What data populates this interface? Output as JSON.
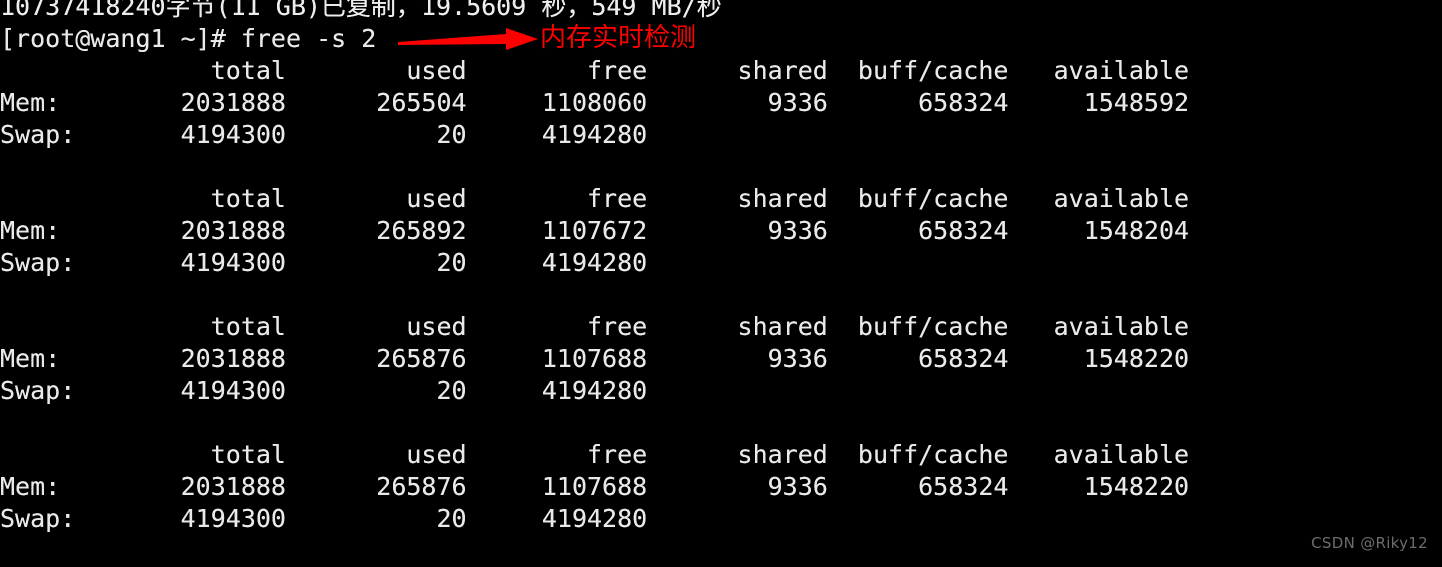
{
  "terminal": {
    "background_color": "#000000",
    "foreground_color": "#e9e9e9",
    "scrollback_top_line": "10737418240字节(11 GB)已复制，19.5609 秒，549 MB/秒",
    "prompt_line": "[root@wang1 ~]# free -s 2"
  },
  "annotation": {
    "color": "#ff0000",
    "text": "内存实时检测",
    "arrow_name": "red-arrow"
  },
  "columns": [
    "total",
    "used",
    "free",
    "shared",
    "buff/cache",
    "available"
  ],
  "row_labels": {
    "mem": "Mem:",
    "swap": "Swap:"
  },
  "blocks": [
    {
      "header": "              total        used        free      shared  buff/cache   available",
      "mem": "Mem:        2031888      265504     1108060        9336      658324     1548592",
      "swap": "Swap:       4194300          20     4194280",
      "mem_values": {
        "total": "2031888",
        "used": "265504",
        "free": "1108060",
        "shared": "9336",
        "buff_cache": "658324",
        "available": "1548592"
      },
      "swap_values": {
        "total": "4194300",
        "used": "20",
        "free": "4194280"
      }
    },
    {
      "header": "              total        used        free      shared  buff/cache   available",
      "mem": "Mem:        2031888      265892     1107672        9336      658324     1548204",
      "swap": "Swap:       4194300          20     4194280",
      "mem_values": {
        "total": "2031888",
        "used": "265892",
        "free": "1107672",
        "shared": "9336",
        "buff_cache": "658324",
        "available": "1548204"
      },
      "swap_values": {
        "total": "4194300",
        "used": "20",
        "free": "4194280"
      }
    },
    {
      "header": "              total        used        free      shared  buff/cache   available",
      "mem": "Mem:        2031888      265876     1107688        9336      658324     1548220",
      "swap": "Swap:       4194300          20     4194280",
      "mem_values": {
        "total": "2031888",
        "used": "265876",
        "free": "1107688",
        "shared": "9336",
        "buff_cache": "658324",
        "available": "1548220"
      },
      "swap_values": {
        "total": "4194300",
        "used": "20",
        "free": "4194280"
      }
    },
    {
      "header": "              total        used        free      shared  buff/cache   available",
      "mem": "Mem:        2031888      265876     1107688        9336      658324     1548220",
      "swap": "Swap:       4194300          20     4194280",
      "mem_values": {
        "total": "2031888",
        "used": "265876",
        "free": "1107688",
        "shared": "9336",
        "buff_cache": "658324",
        "available": "1548220"
      },
      "swap_values": {
        "total": "4194300",
        "used": "20",
        "free": "4194280"
      }
    }
  ],
  "watermark": "CSDN @Riky12"
}
